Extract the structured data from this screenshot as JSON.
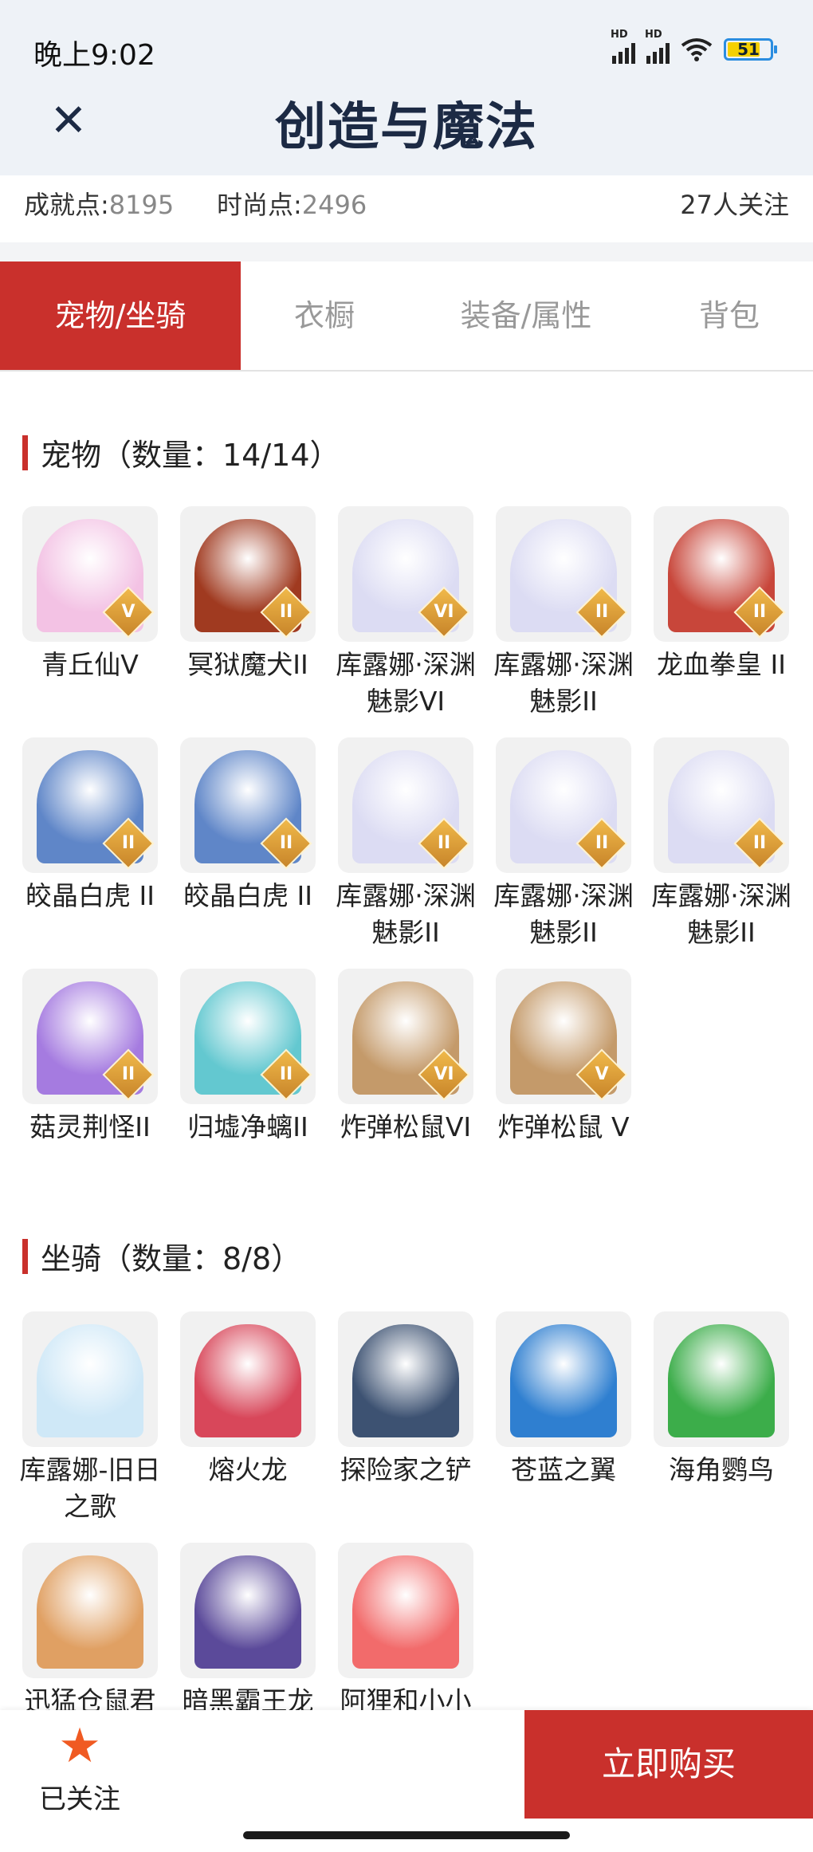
{
  "status_bar": {
    "time": "晚上9:02",
    "battery": "51",
    "network": "HD"
  },
  "header": {
    "title": "创造与魔法"
  },
  "stats": {
    "achievement_label": "成就点:",
    "achievement_value": "8195",
    "fashion_label": "时尚点:",
    "fashion_value": "2496",
    "followers": "27人关注"
  },
  "tabs": [
    {
      "label": "宠物/坐骑",
      "active": true
    },
    {
      "label": "衣橱"
    },
    {
      "label": "装备/属性"
    },
    {
      "label": "背包"
    }
  ],
  "pets": {
    "title": "宠物（数量：14/14）",
    "items": [
      {
        "name": "青丘仙V",
        "badge": "V",
        "color": "#f3c2e4"
      },
      {
        "name": "冥狱魔犬II",
        "badge": "II",
        "color": "#a03a20"
      },
      {
        "name": "库露娜·深渊魅影VI",
        "badge": "VI",
        "color": "#dcdcf3"
      },
      {
        "name": "库露娜·深渊魅影II",
        "badge": "II",
        "color": "#dcdcf3"
      },
      {
        "name": "龙血拳皇 II",
        "badge": "II",
        "color": "#c8463a"
      },
      {
        "name": "皎晶白虎 II",
        "badge": "II",
        "color": "#5f86c8"
      },
      {
        "name": "皎晶白虎 II",
        "badge": "II",
        "color": "#5f86c8"
      },
      {
        "name": "库露娜·深渊魅影II",
        "badge": "II",
        "color": "#dcdcf3"
      },
      {
        "name": "库露娜·深渊魅影II",
        "badge": "II",
        "color": "#dcdcf3"
      },
      {
        "name": "库露娜·深渊魅影II",
        "badge": "II",
        "color": "#dcdcf3"
      },
      {
        "name": "菇灵荆怪II",
        "badge": "II",
        "color": "#a57be0"
      },
      {
        "name": "归墟净螭II",
        "badge": "II",
        "color": "#63c8d0"
      },
      {
        "name": "炸弹松鼠VI",
        "badge": "VI",
        "color": "#c49a6a"
      },
      {
        "name": "炸弹松鼠 V",
        "badge": "V",
        "color": "#c49a6a"
      }
    ]
  },
  "mounts": {
    "title": "坐骑（数量：8/8）",
    "items": [
      {
        "name": "库露娜-旧日之歌",
        "color": "#cfe8f7"
      },
      {
        "name": "熔火龙",
        "color": "#d8475a"
      },
      {
        "name": "探险家之铲",
        "color": "#3d5272"
      },
      {
        "name": "苍蓝之翼",
        "color": "#2f7fd0"
      },
      {
        "name": "海角鹦鸟",
        "color": "#3cad4a"
      },
      {
        "name": "迅猛仓鼠君",
        "color": "#e0a063"
      },
      {
        "name": "暗黑霸王龙",
        "color": "#5b4a9a"
      },
      {
        "name": "阿狸和小小",
        "color": "#f26b6b"
      }
    ]
  },
  "bottom": {
    "follow_label": "已关注",
    "buy_label": "立即购买"
  }
}
